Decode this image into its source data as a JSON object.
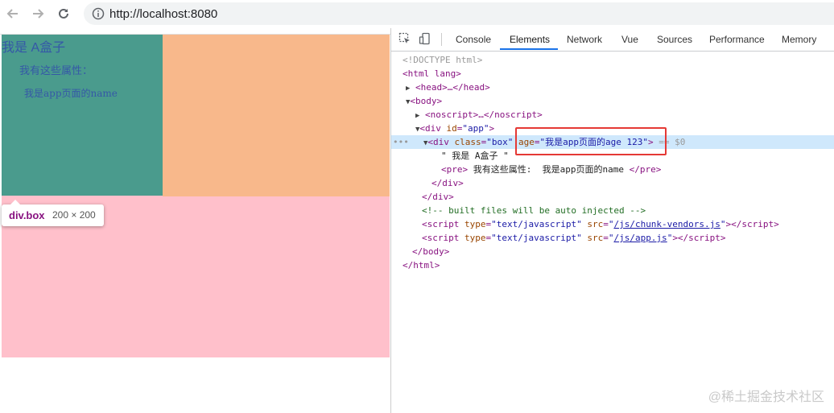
{
  "browser": {
    "url": "http://localhost:8080",
    "back_icon": "arrow-left-icon",
    "forward_icon": "arrow-right-icon",
    "reload_icon": "reload-icon",
    "info_icon": "info-icon"
  },
  "page": {
    "box_title": "我是 A盒子",
    "pre_line1": "我有这些属性：",
    "pre_line2": "我是app页面的name",
    "colors": {
      "teal": "#4a9b8d",
      "orange": "#f8b88b",
      "pink": "#ffc0cb",
      "text": "#3558a7"
    }
  },
  "tooltip": {
    "selector": "div.box",
    "dims": "200 × 200"
  },
  "devtools": {
    "tabs": [
      "Console",
      "Elements",
      "Network",
      "Vue",
      "Sources",
      "Performance",
      "Memory"
    ],
    "active_tab": "Elements",
    "code": {
      "doctype": "<!DOCTYPE html>",
      "html_open": "<html lang>",
      "head": "<head>…</head>",
      "body_open": "<body>",
      "noscript": "<noscript>…</noscript>",
      "div_app_open": "<div ",
      "div_app_attr_name": "id",
      "div_app_attr_val": "\"app\"",
      "div_box_open": "<div ",
      "class_name": "class",
      "class_val": "\"box\"",
      "age_name": "age",
      "age_val": "\"我是app页面的age 123\"",
      "equals_ref": "== $0",
      "text_node": "\" 我是 A盒子 \"",
      "pre_open": "<pre>",
      "pre_text": " 我有这些属性:  我是app页面的name ",
      "pre_close": "</pre>",
      "div_close1": "</div>",
      "div_close2": "</div>",
      "comment": "<!-- built files will be auto injected -->",
      "script1_src": "/js/chunk-vendors.js",
      "script2_src": "/js/app.js",
      "script_type_val": "\"text/javascript\"",
      "body_close": "</body>",
      "html_close": "</html>",
      "dots": "•••"
    }
  },
  "watermark": "@稀土掘金技术社区"
}
